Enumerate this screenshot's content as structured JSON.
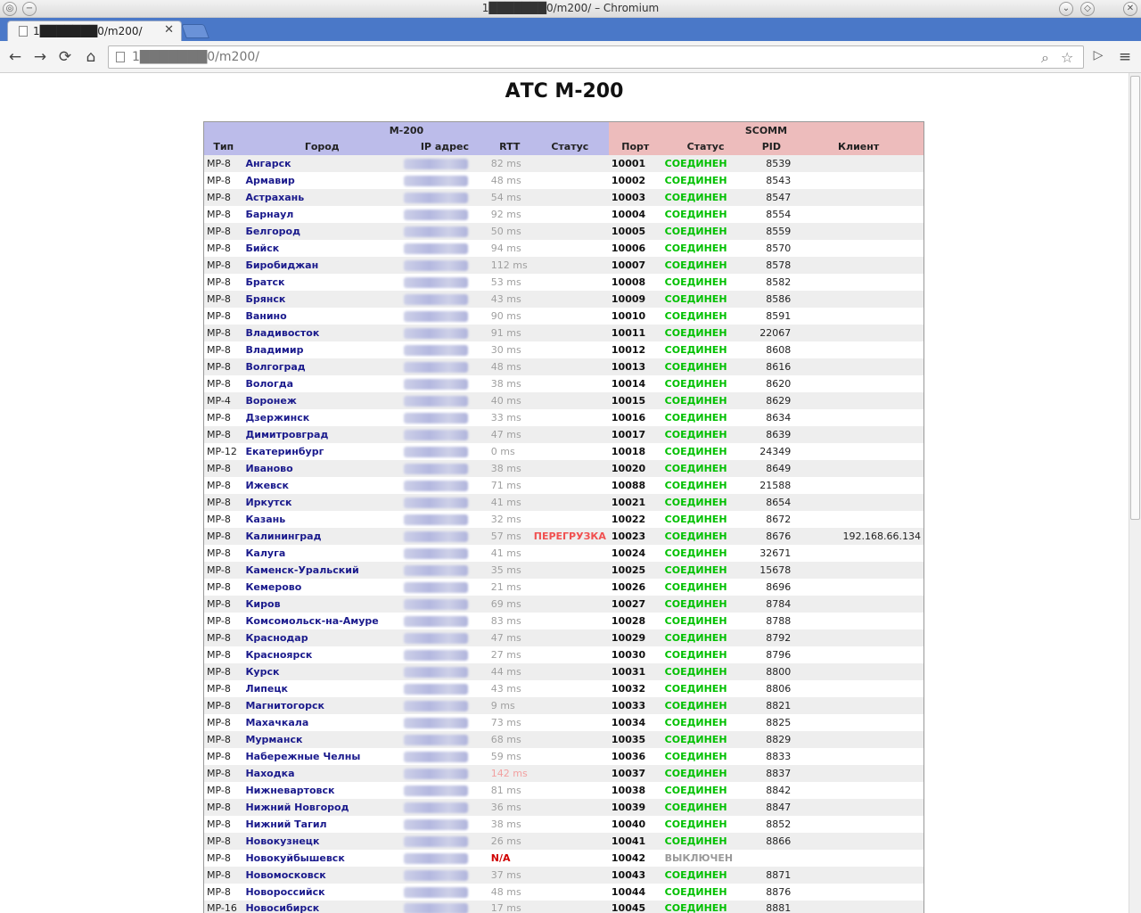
{
  "window": {
    "title": "1███████0/m200/ – Chromium"
  },
  "tab": {
    "title": "1███████0/m200/",
    "close": "✕"
  },
  "toolbar": {
    "back": "←",
    "forward": "→",
    "reload": "⟳",
    "home": "⌂",
    "url": "1███████0/m200/",
    "menu": "≡"
  },
  "page": {
    "title": "АТС М-200"
  },
  "table": {
    "group_m200": "M-200",
    "group_scomm": "SCOMM",
    "headers": [
      "Тип",
      "Город",
      "IP адрес",
      "RTT",
      "Статус",
      "Порт",
      "Статус",
      "PID",
      "Клиент"
    ],
    "rows": [
      {
        "type": "MP-8",
        "city": "Ангарск",
        "rtt": "82 ms",
        "status": "",
        "port": "10001",
        "sstatus": "СОЕДИНЕН",
        "pid": "8539",
        "client": ""
      },
      {
        "type": "MP-8",
        "city": "Армавир",
        "rtt": "48 ms",
        "status": "",
        "port": "10002",
        "sstatus": "СОЕДИНЕН",
        "pid": "8543",
        "client": ""
      },
      {
        "type": "MP-8",
        "city": "Астрахань",
        "rtt": "54 ms",
        "status": "",
        "port": "10003",
        "sstatus": "СОЕДИНЕН",
        "pid": "8547",
        "client": ""
      },
      {
        "type": "MP-8",
        "city": "Барнаул",
        "rtt": "92 ms",
        "status": "",
        "port": "10004",
        "sstatus": "СОЕДИНЕН",
        "pid": "8554",
        "client": ""
      },
      {
        "type": "MP-8",
        "city": "Белгород",
        "rtt": "50 ms",
        "status": "",
        "port": "10005",
        "sstatus": "СОЕДИНЕН",
        "pid": "8559",
        "client": ""
      },
      {
        "type": "MP-8",
        "city": "Бийск",
        "rtt": "94 ms",
        "status": "",
        "port": "10006",
        "sstatus": "СОЕДИНЕН",
        "pid": "8570",
        "client": ""
      },
      {
        "type": "MP-8",
        "city": "Биробиджан",
        "rtt": "112 ms",
        "status": "",
        "port": "10007",
        "sstatus": "СОЕДИНЕН",
        "pid": "8578",
        "client": ""
      },
      {
        "type": "MP-8",
        "city": "Братск",
        "rtt": "53 ms",
        "status": "",
        "port": "10008",
        "sstatus": "СОЕДИНЕН",
        "pid": "8582",
        "client": ""
      },
      {
        "type": "MP-8",
        "city": "Брянск",
        "rtt": "43 ms",
        "status": "",
        "port": "10009",
        "sstatus": "СОЕДИНЕН",
        "pid": "8586",
        "client": ""
      },
      {
        "type": "MP-8",
        "city": "Ванино",
        "rtt": "90 ms",
        "status": "",
        "port": "10010",
        "sstatus": "СОЕДИНЕН",
        "pid": "8591",
        "client": ""
      },
      {
        "type": "MP-8",
        "city": "Владивосток",
        "rtt": "91 ms",
        "status": "",
        "port": "10011",
        "sstatus": "СОЕДИНЕН",
        "pid": "22067",
        "client": ""
      },
      {
        "type": "MP-8",
        "city": "Владимир",
        "rtt": "30 ms",
        "status": "",
        "port": "10012",
        "sstatus": "СОЕДИНЕН",
        "pid": "8608",
        "client": ""
      },
      {
        "type": "MP-8",
        "city": "Волгоград",
        "rtt": "48 ms",
        "status": "",
        "port": "10013",
        "sstatus": "СОЕДИНЕН",
        "pid": "8616",
        "client": ""
      },
      {
        "type": "MP-8",
        "city": "Вологда",
        "rtt": "38 ms",
        "status": "",
        "port": "10014",
        "sstatus": "СОЕДИНЕН",
        "pid": "8620",
        "client": ""
      },
      {
        "type": "MP-4",
        "city": "Воронеж",
        "rtt": "40 ms",
        "status": "",
        "port": "10015",
        "sstatus": "СОЕДИНЕН",
        "pid": "8629",
        "client": ""
      },
      {
        "type": "MP-8",
        "city": "Дзержинск",
        "rtt": "33 ms",
        "status": "",
        "port": "10016",
        "sstatus": "СОЕДИНЕН",
        "pid": "8634",
        "client": ""
      },
      {
        "type": "MP-8",
        "city": "Димитровград",
        "rtt": "47 ms",
        "status": "",
        "port": "10017",
        "sstatus": "СОЕДИНЕН",
        "pid": "8639",
        "client": ""
      },
      {
        "type": "MP-12",
        "city": "Екатеринбург",
        "rtt": "0 ms",
        "status": "",
        "port": "10018",
        "sstatus": "СОЕДИНЕН",
        "pid": "24349",
        "client": ""
      },
      {
        "type": "MP-8",
        "city": "Иваново",
        "rtt": "38 ms",
        "status": "",
        "port": "10020",
        "sstatus": "СОЕДИНЕН",
        "pid": "8649",
        "client": ""
      },
      {
        "type": "MP-8",
        "city": "Ижевск",
        "rtt": "71 ms",
        "status": "",
        "port": "10088",
        "sstatus": "СОЕДИНЕН",
        "pid": "21588",
        "client": ""
      },
      {
        "type": "MP-8",
        "city": "Иркутск",
        "rtt": "41 ms",
        "status": "",
        "port": "10021",
        "sstatus": "СОЕДИНЕН",
        "pid": "8654",
        "client": ""
      },
      {
        "type": "MP-8",
        "city": "Казань",
        "rtt": "32 ms",
        "status": "",
        "port": "10022",
        "sstatus": "СОЕДИНЕН",
        "pid": "8672",
        "client": ""
      },
      {
        "type": "MP-8",
        "city": "Калининград",
        "rtt": "57 ms",
        "status": "ПЕРЕГРУЗКА",
        "port": "10023",
        "sstatus": "СОЕДИНЕН",
        "pid": "8676",
        "client": "192.168.66.134"
      },
      {
        "type": "MP-8",
        "city": "Калуга",
        "rtt": "41 ms",
        "status": "",
        "port": "10024",
        "sstatus": "СОЕДИНЕН",
        "pid": "32671",
        "client": ""
      },
      {
        "type": "MP-8",
        "city": "Каменск-Уральский",
        "rtt": "35 ms",
        "status": "",
        "port": "10025",
        "sstatus": "СОЕДИНЕН",
        "pid": "15678",
        "client": ""
      },
      {
        "type": "MP-8",
        "city": "Кемерово",
        "rtt": "21 ms",
        "status": "",
        "port": "10026",
        "sstatus": "СОЕДИНЕН",
        "pid": "8696",
        "client": ""
      },
      {
        "type": "MP-8",
        "city": "Киров",
        "rtt": "69 ms",
        "status": "",
        "port": "10027",
        "sstatus": "СОЕДИНЕН",
        "pid": "8784",
        "client": ""
      },
      {
        "type": "MP-8",
        "city": "Комсомольск-на-Амуре",
        "rtt": "83 ms",
        "status": "",
        "port": "10028",
        "sstatus": "СОЕДИНЕН",
        "pid": "8788",
        "client": ""
      },
      {
        "type": "MP-8",
        "city": "Краснодар",
        "rtt": "47 ms",
        "status": "",
        "port": "10029",
        "sstatus": "СОЕДИНЕН",
        "pid": "8792",
        "client": ""
      },
      {
        "type": "MP-8",
        "city": "Красноярск",
        "rtt": "27 ms",
        "status": "",
        "port": "10030",
        "sstatus": "СОЕДИНЕН",
        "pid": "8796",
        "client": ""
      },
      {
        "type": "MP-8",
        "city": "Курск",
        "rtt": "44 ms",
        "status": "",
        "port": "10031",
        "sstatus": "СОЕДИНЕН",
        "pid": "8800",
        "client": ""
      },
      {
        "type": "MP-8",
        "city": "Липецк",
        "rtt": "43 ms",
        "status": "",
        "port": "10032",
        "sstatus": "СОЕДИНЕН",
        "pid": "8806",
        "client": ""
      },
      {
        "type": "MP-8",
        "city": "Магнитогорск",
        "rtt": "9 ms",
        "status": "",
        "port": "10033",
        "sstatus": "СОЕДИНЕН",
        "pid": "8821",
        "client": ""
      },
      {
        "type": "MP-8",
        "city": "Махачкала",
        "rtt": "73 ms",
        "status": "",
        "port": "10034",
        "sstatus": "СОЕДИНЕН",
        "pid": "8825",
        "client": ""
      },
      {
        "type": "MP-8",
        "city": "Мурманск",
        "rtt": "68 ms",
        "status": "",
        "port": "10035",
        "sstatus": "СОЕДИНЕН",
        "pid": "8829",
        "client": ""
      },
      {
        "type": "MP-8",
        "city": "Набережные Челны",
        "rtt": "59 ms",
        "status": "",
        "port": "10036",
        "sstatus": "СОЕДИНЕН",
        "pid": "8833",
        "client": ""
      },
      {
        "type": "MP-8",
        "city": "Находка",
        "rtt": "142 ms",
        "rtt_class": "high",
        "status": "",
        "port": "10037",
        "sstatus": "СОЕДИНЕН",
        "pid": "8837",
        "client": ""
      },
      {
        "type": "MP-8",
        "city": "Нижневартовск",
        "rtt": "81 ms",
        "status": "",
        "port": "10038",
        "sstatus": "СОЕДИНЕН",
        "pid": "8842",
        "client": ""
      },
      {
        "type": "MP-8",
        "city": "Нижний Новгород",
        "rtt": "36 ms",
        "status": "",
        "port": "10039",
        "sstatus": "СОЕДИНЕН",
        "pid": "8847",
        "client": ""
      },
      {
        "type": "MP-8",
        "city": "Нижний Тагил",
        "rtt": "38 ms",
        "status": "",
        "port": "10040",
        "sstatus": "СОЕДИНЕН",
        "pid": "8852",
        "client": ""
      },
      {
        "type": "MP-8",
        "city": "Новокузнецк",
        "rtt": "26 ms",
        "status": "",
        "port": "10041",
        "sstatus": "СОЕДИНЕН",
        "pid": "8866",
        "client": ""
      },
      {
        "type": "MP-8",
        "city": "Новокуйбышевск",
        "rtt": "N/A",
        "rtt_class": "na",
        "status": "",
        "port": "10042",
        "sstatus": "ВЫКЛЮЧЕН",
        "sstatus_class": "off",
        "pid": "",
        "client": ""
      },
      {
        "type": "MP-8",
        "city": "Новомосковск",
        "rtt": "37 ms",
        "status": "",
        "port": "10043",
        "sstatus": "СОЕДИНЕН",
        "pid": "8871",
        "client": ""
      },
      {
        "type": "MP-8",
        "city": "Новороссийск",
        "rtt": "48 ms",
        "status": "",
        "port": "10044",
        "sstatus": "СОЕДИНЕН",
        "pid": "8876",
        "client": ""
      },
      {
        "type": "MP-16",
        "city": "Новосибирск",
        "rtt": "17 ms",
        "status": "",
        "port": "10045",
        "sstatus": "СОЕДИНЕН",
        "pid": "8881",
        "client": ""
      }
    ]
  },
  "colors": {
    "m200_header": "#bcbcea",
    "scomm_header": "#edbcbc",
    "connected": "#00c000",
    "off": "#9a9a9a",
    "overload": "#f05050",
    "na": "#d00000"
  }
}
